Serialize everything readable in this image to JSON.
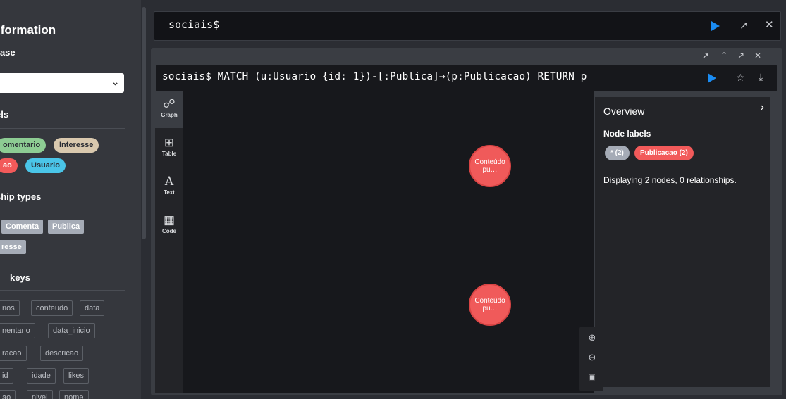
{
  "sidebar": {
    "title": "se Information",
    "database_section": "base",
    "database_select_value": "",
    "node_labels_section": "els",
    "node_labels": [
      {
        "label": "omentario",
        "color": "#8dcc93",
        "text_color": "#2a2c34"
      },
      {
        "label": "Interesse",
        "color": "#d9c8ae",
        "text_color": "#2a2c34"
      },
      {
        "label": "ao",
        "color": "#f25a5a",
        "text_color": "#ffffff"
      },
      {
        "label": "Usuario",
        "color": "#4ac5e8",
        "text_color": "#2a2c34"
      }
    ],
    "rel_types_section": "ship types",
    "rel_types": [
      "Comenta",
      "Publica",
      "resse"
    ],
    "property_keys_section": "keys",
    "property_keys": [
      "rios",
      "conteudo",
      "data",
      "nentario",
      "data_inicio",
      "racao",
      "descricao",
      "id",
      "idade",
      "likes",
      "ao",
      "nivel",
      "nome"
    ]
  },
  "top_editor": {
    "prompt": "sociais$",
    "run_icon": "play-icon",
    "expand_icon": "expand-icon",
    "close_icon": "close-icon"
  },
  "result_frame": {
    "tools": {
      "pin": "pin-icon",
      "collapse": "chevron-up-icon",
      "expand": "expand-icon",
      "close": "close-icon"
    },
    "query": "sociais$ MATCH (u:Usuario {id: 1})-[:Publica]→(p:Publicacao) RETURN p",
    "favorite_icon": "star-icon",
    "download_icon": "download-icon",
    "tabs": [
      {
        "label": "Graph",
        "icon": "graph-icon",
        "active": true
      },
      {
        "label": "Table",
        "icon": "table-icon",
        "active": false
      },
      {
        "label": "Text",
        "icon": "text-icon",
        "active": false
      },
      {
        "label": "Code",
        "icon": "code-icon",
        "active": false
      }
    ],
    "nodes": [
      {
        "caption_line1": "Conteúdo",
        "caption_line2": "pu…",
        "color": "#f05a5a"
      },
      {
        "caption_line1": "Conteúdo",
        "caption_line2": "pu…",
        "color": "#f05a5a"
      }
    ],
    "zoom_controls": [
      "zoom-in-icon",
      "zoom-out-icon",
      "fit-icon"
    ],
    "overview": {
      "title": "Overview",
      "node_labels_heading": "Node labels",
      "badges": [
        {
          "label": "* (2)",
          "color": "#a5abb6"
        },
        {
          "label": "Publicacao (2)",
          "color": "#f25a5a"
        }
      ],
      "summary": "Displaying 2 nodes, 0 relationships."
    }
  }
}
